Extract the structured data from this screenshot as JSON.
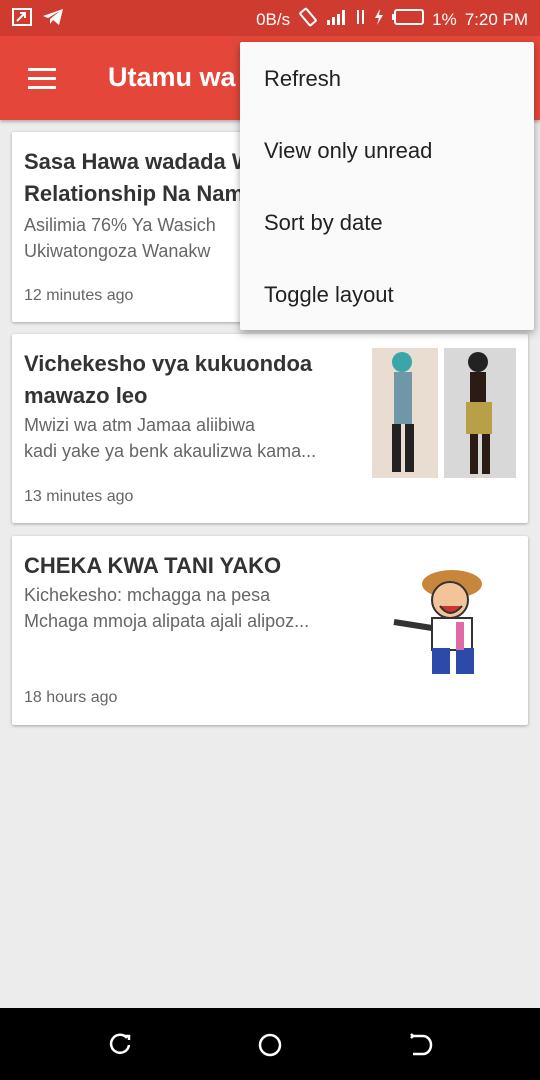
{
  "status_bar": {
    "speed": "0B/s",
    "battery": "1%",
    "time": "7:20 PM",
    "icons": [
      "screenshot-icon",
      "telegram-icon",
      "rotate-icon",
      "signal-icon",
      "data-icon",
      "charging-icon",
      "battery-icon"
    ]
  },
  "app_bar": {
    "title": "Utamu wa",
    "menu_icon": "hamburger-icon"
  },
  "articles": [
    {
      "title_line1": "Sasa Hawa wadada W",
      "title_line2": "Relationship Na Nam",
      "summary_line1": "Asilimia 76% Ya Wasich",
      "summary_line2": "Ukiwatongoza Wanakw",
      "time": "12 minutes ago"
    },
    {
      "title_line1": "Vichekesho vya kukuondoa",
      "title_line2": "mawazo leo",
      "summary_line1": "Mwizi wa atm Jamaa aliibiwa",
      "summary_line2": "kadi yake ya benk akaulizwa kama...",
      "time": "13 minutes ago",
      "image_caption": "photo"
    },
    {
      "title_line1": "CHEKA KWA TANI YAKO",
      "summary_line1": "Kichekesho: mchagga na pesa",
      "summary_line2": "Mchaga mmoja alipata ajali alipoz...",
      "time": "18 hours ago"
    }
  ],
  "overflow_menu": {
    "items": [
      "Refresh",
      "View only unread",
      "Sort by date",
      "Toggle layout"
    ]
  },
  "nav_bar": {
    "icons": [
      "recent-apps-icon",
      "home-icon",
      "back-icon"
    ]
  },
  "colors": {
    "primary": "#e4473a",
    "status_bar": "#d03b2f",
    "background": "#ececec"
  }
}
